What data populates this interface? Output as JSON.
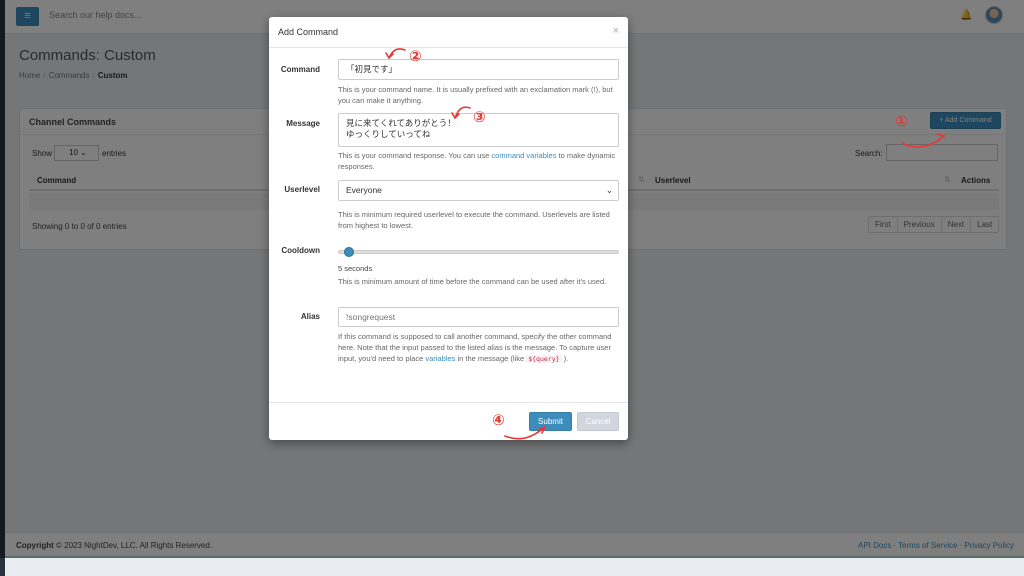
{
  "topbar": {
    "search_placeholder": "Search our help docs...",
    "menu_icon": "hamburger-icon",
    "bell_icon": "bell-icon"
  },
  "page": {
    "title": "Commands: Custom",
    "breadcrumb": [
      "Home",
      "Commands",
      "Custom"
    ]
  },
  "panel": {
    "title": "Channel Commands",
    "add_button": "+ Add Command",
    "show_label": "Show",
    "entries_value": "10",
    "entries_label": "entries",
    "search_label": "Search:",
    "columns": [
      "Command",
      "Userlevel",
      "Actions"
    ],
    "info": "Showing 0 to 0 of 0 entries",
    "pager": [
      "First",
      "Previous",
      "Next",
      "Last"
    ]
  },
  "modal": {
    "title": "Add Command",
    "command_label": "Command",
    "command_value": "「初見です」",
    "command_help": "This is your command name. It is usually prefixed with an exclamation mark (!), but you can make it anything.",
    "message_label": "Message",
    "message_line1": "見に来てくれてありがとう！",
    "message_line2": "ゆっくりしていってね",
    "message_help_pre": "This is your command response. You can use ",
    "message_help_link": "command variables",
    "message_help_post": " to make dynamic responses.",
    "userlevel_label": "Userlevel",
    "userlevel_value": "Everyone",
    "userlevel_help": "This is minimum required userlevel to execute the command. Userlevels are listed from highest to lowest.",
    "cooldown_label": "Cooldown",
    "cooldown_value": "5 seconds",
    "cooldown_help": "This is minimum amount of time before the command can be used after it's used.",
    "alias_label": "Alias",
    "alias_placeholder": "!songrequest",
    "alias_help_pre": "If this command is supposed to call another command, specify the other command here. Note that the input passed to the listed alias is the message. To capture user input, you'd need to place ",
    "alias_help_link": "variables",
    "alias_help_mid": " in the message (like ",
    "alias_help_code": "${query}",
    "alias_help_post": " ).",
    "submit_label": "Submit",
    "cancel_label": "Cancel",
    "close_glyph": "×"
  },
  "footer": {
    "copyright_bold": "Copyright",
    "copyright_rest": " © 2023 NightDev, LLC. All Rights Reserved.",
    "links": [
      "API Docs",
      "Terms of Service",
      "Privacy Policy"
    ]
  },
  "annotations": {
    "step1": "①",
    "step2": "②",
    "step3": "③",
    "step4": "④",
    "color": "#e53935"
  }
}
